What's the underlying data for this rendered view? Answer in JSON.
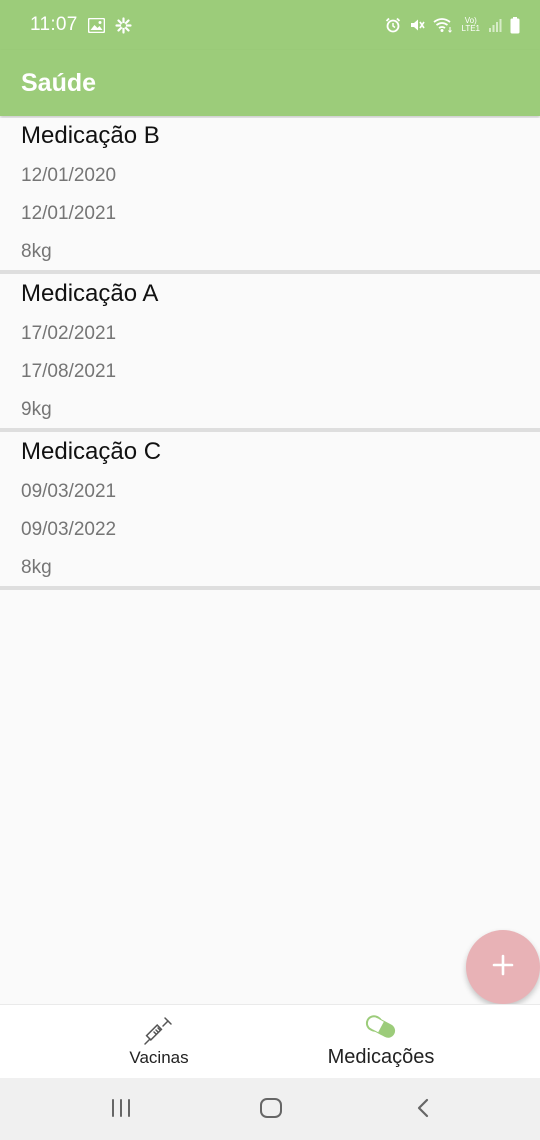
{
  "status_bar": {
    "time": "11:07",
    "left_icons": [
      "image-icon",
      "settings-flower-icon"
    ],
    "right_icons": [
      "alarm-icon",
      "mute-icon",
      "wifi-icon",
      "volte-lte-icon",
      "signal-icon",
      "battery-icon"
    ],
    "network_label_top": "Vo)",
    "network_label_bottom": "LTE1"
  },
  "app_bar": {
    "title": "Saúde",
    "color": "#9ccc7a"
  },
  "medications": [
    {
      "name": "Medicação B",
      "start_date": "12/01/2020",
      "end_date": "12/01/2021",
      "weight": "8kg"
    },
    {
      "name": "Medicação A",
      "start_date": "17/02/2021",
      "end_date": "17/08/2021",
      "weight": "9kg"
    },
    {
      "name": "Medicação C",
      "start_date": "09/03/2021",
      "end_date": "09/03/2022",
      "weight": "8kg"
    }
  ],
  "fab": {
    "icon": "plus-icon",
    "color": "#e8b2b6"
  },
  "bottom_nav": {
    "items": [
      {
        "label": "Vacinas",
        "icon": "syringe-icon",
        "active": false
      },
      {
        "label": "Medicações",
        "icon": "pill-icon",
        "active": true
      }
    ]
  },
  "system_nav": {
    "icons": [
      "recent-apps-icon",
      "home-icon",
      "back-icon"
    ]
  }
}
